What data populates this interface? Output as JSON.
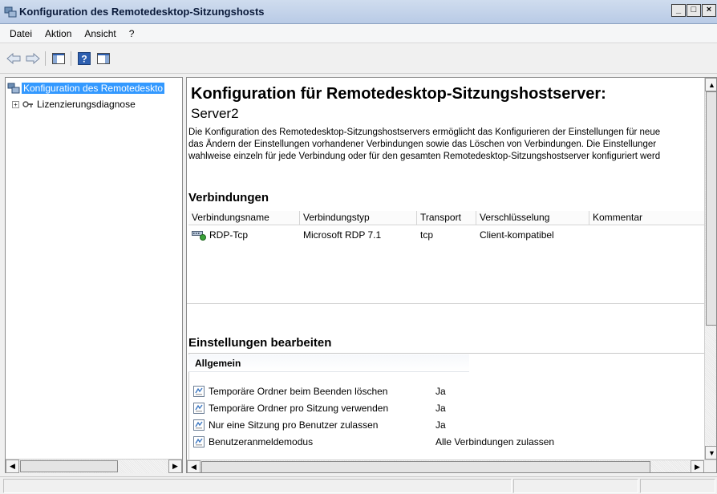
{
  "window": {
    "title": "Konfiguration des Remotedesktop-Sitzungshosts",
    "buttons": [
      "_",
      "□",
      "×"
    ]
  },
  "menu": {
    "items": [
      {
        "label": "Datei",
        "mnemonic": "D"
      },
      {
        "label": "Aktion",
        "mnemonic": "t"
      },
      {
        "label": "Ansicht",
        "mnemonic": "A"
      },
      {
        "label": "?",
        "mnemonic": "?"
      }
    ]
  },
  "toolbar": {
    "icons": [
      "back-arrow-icon",
      "forward-arrow-icon",
      "show-hide-tree-icon",
      "help-icon",
      "action-pane-icon"
    ]
  },
  "tree": {
    "root_label": "Konfiguration des Remotedeskto",
    "child_label": "Lizenzierungsdiagnose"
  },
  "main": {
    "heading": "Konfiguration für Remotedesktop-Sitzungshostserver:",
    "server_name": "Server2",
    "description": [
      "Die Konfiguration des Remotedesktop-Sitzungshostservers ermöglicht das Konfigurieren der Einstellungen für neue",
      "das Ändern der Einstellungen vorhandener Verbindungen sowie das Löschen von Verbindungen. Die Einstellunger",
      "wahlweise einzeln für jede Verbindung oder für den gesamten Remotedesktop-Sitzungshostserver konfiguriert werd"
    ],
    "connections": {
      "title": "Verbindungen",
      "columns": [
        "Verbindungsname",
        "Verbindungstyp",
        "Transport",
        "Verschlüsselung",
        "Kommentar"
      ],
      "rows": [
        {
          "name": "RDP-Tcp",
          "type": "Microsoft RDP 7.1",
          "transport": "tcp",
          "encryption": "Client-kompatibel",
          "comment": ""
        }
      ]
    },
    "settings": {
      "title": "Einstellungen bearbeiten",
      "group": "Allgemein",
      "items": [
        {
          "label": "Temporäre Ordner beim Beenden löschen",
          "value": "Ja"
        },
        {
          "label": "Temporäre Ordner pro Sitzung verwenden",
          "value": "Ja"
        },
        {
          "label": "Nur eine Sitzung pro Benutzer zulassen",
          "value": "Ja"
        },
        {
          "label": "Benutzeranmeldemodus",
          "value": "Alle Verbindungen zulassen"
        }
      ]
    }
  },
  "colors": {
    "selection": "#3399ff",
    "titlebar": "#b9cbe6"
  }
}
